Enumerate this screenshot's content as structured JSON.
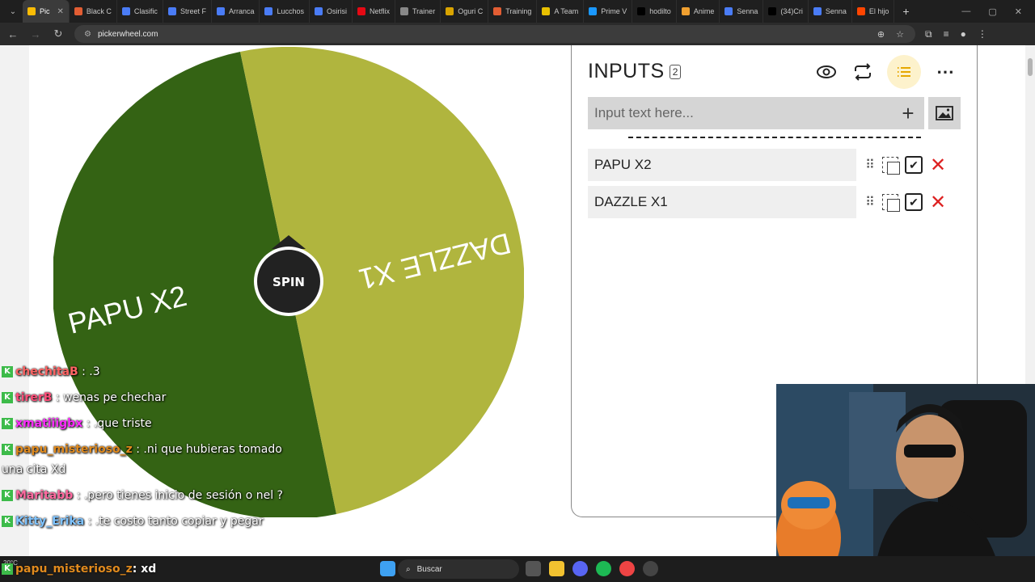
{
  "browser": {
    "tabs": [
      {
        "label": "Pic",
        "color": "#fbbc05",
        "active": true
      },
      {
        "label": "Black C",
        "color": "#e25d33"
      },
      {
        "label": "Clasific",
        "color": "#4a7cf6"
      },
      {
        "label": "Street F",
        "color": "#4a7cf6"
      },
      {
        "label": "Arranca",
        "color": "#4a7cf6"
      },
      {
        "label": "Lucchos",
        "color": "#4a7cf6"
      },
      {
        "label": "Osirisi",
        "color": "#4a7cf6"
      },
      {
        "label": "Netflix",
        "color": "#e50914"
      },
      {
        "label": "Trainer",
        "color": "#888888"
      },
      {
        "label": "Oguri C",
        "color": "#d9a400"
      },
      {
        "label": "Training",
        "color": "#e25d33"
      },
      {
        "label": "A Team",
        "color": "#e8c000"
      },
      {
        "label": "Prime V",
        "color": "#1a98ff"
      },
      {
        "label": "hodilto",
        "color": "#000000"
      },
      {
        "label": "Anime",
        "color": "#f0a030"
      },
      {
        "label": "Senna",
        "color": "#4a7cf6"
      },
      {
        "label": "(34)Cri",
        "color": "#000000"
      },
      {
        "label": "Senna",
        "color": "#4a7cf6"
      },
      {
        "label": "El hijo",
        "color": "#ff4500"
      }
    ],
    "url": "pickerwheel.com"
  },
  "wheel": {
    "spin_label": "SPIN",
    "segments": [
      {
        "label": "PAPU X2",
        "color": "#346314"
      },
      {
        "label": "DAZZLE X1",
        "color": "#b0b53e"
      }
    ]
  },
  "inputs_panel": {
    "title": "INPUTS",
    "count": "2",
    "input_placeholder": "Input text here...",
    "entries": [
      {
        "label": "PAPU X2"
      },
      {
        "label": "DAZZLE X1"
      }
    ]
  },
  "chat": {
    "messages": [
      {
        "user": "chechitaB",
        "text": ": .3",
        "color": "#ff6464"
      },
      {
        "user": "tirerB",
        "text": ": wenas pe chechar",
        "color": "#ff4f7a"
      },
      {
        "user": "xmatiiigbx",
        "text": ": .que triste",
        "color": "#ff2aff"
      },
      {
        "user": "papu_misterioso_z",
        "text": ": .ni que hubieras tomado una cita Xd",
        "color": "#e08a1e"
      },
      {
        "user": "Maritabb",
        "text": ": .pero tienes inicio de sesión o nel ?",
        "color": "#ff6aa0"
      },
      {
        "user": "Kitty_Erika",
        "text": ": .te costo tanto copiar y pegar",
        "color": "#7ec3ff"
      }
    ],
    "last": {
      "user": "papu_misterioso_z",
      "text": ": xd",
      "color": "#e08a1e"
    }
  },
  "taskbar": {
    "search_label": "Buscar",
    "weather": "20°C"
  }
}
